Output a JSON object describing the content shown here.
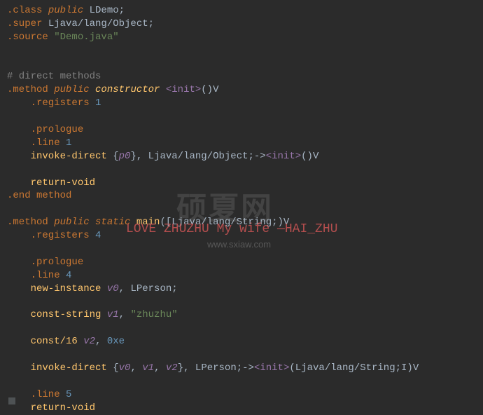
{
  "code": {
    "l1_dir": ".class ",
    "l1_mod": "public ",
    "l1_type": "LDemo",
    "l1_semi": ";",
    "l2_dir": ".super ",
    "l2_type": "Ljava/lang/Object",
    "l2_semi": ";",
    "l3_dir": ".source ",
    "l3_str": "\"Demo.java\"",
    "l5_comment": "# direct methods",
    "l6_dir": ".method ",
    "l6_mod": "public ",
    "l6_constr": "constructor ",
    "l6_spec1": "<init>",
    "l6_sig": "()",
    "l6_ret": "V",
    "l7_dir": "    .registers ",
    "l7_num": "1",
    "l9_dir": "    .prologue",
    "l10_dir": "    .line ",
    "l10_num": "1",
    "l11_op": "    invoke-direct ",
    "l11_brace1": "{",
    "l11_var": "p0",
    "l11_brace2": "}",
    "l11_comma": ", ",
    "l11_type": "Ljava/lang/Object",
    "l11_semi": ";",
    "l11_arrow": "->",
    "l11_spec": "<init>",
    "l11_sig": "()",
    "l11_ret": "V",
    "l13_op": "    return-void",
    "l14_dir": ".end method",
    "l16_dir": ".method ",
    "l16_mod1": "public ",
    "l16_mod2": "static ",
    "l16_func": "main",
    "l16_paren1": "(",
    "l16_arr": "[",
    "l16_type": "Ljava/lang/String",
    "l16_semi": ";",
    "l16_paren2": ")",
    "l16_ret": "V",
    "l17_dir": "    .registers ",
    "l17_num": "4",
    "l19_dir": "    .prologue",
    "l20_dir": "    .line ",
    "l20_num": "4",
    "l21_op": "    new-instance ",
    "l21_var": "v0",
    "l21_comma": ", ",
    "l21_type": "LPerson",
    "l21_semi": ";",
    "l23_op": "    const-string ",
    "l23_var": "v1",
    "l23_comma": ", ",
    "l23_str": "\"zhuzhu\"",
    "l25_op": "    const/16 ",
    "l25_var": "v2",
    "l25_comma": ", ",
    "l25_num": "0xe",
    "l27_op": "    invoke-direct ",
    "l27_brace1": "{",
    "l27_v0": "v0",
    "l27_c1": ", ",
    "l27_v1": "v1",
    "l27_c2": ", ",
    "l27_v2": "v2",
    "l27_brace2": "}",
    "l27_comma": ", ",
    "l27_type": "LPerson",
    "l27_semi": ";",
    "l27_arrow": "->",
    "l27_spec": "<init>",
    "l27_paren1": "(",
    "l27_ptype": "Ljava/lang/String",
    "l27_psemi": ";",
    "l27_pi": "I",
    "l27_paren2": ")",
    "l27_ret": "V",
    "l29_dir": "    .line ",
    "l29_num": "5",
    "l30_op": "    return-void"
  },
  "watermark": {
    "logo": "硕夏网",
    "text": "LOVE ZHUZHU My wife —HAI_ZHU",
    "url": "www.sxiaw.com"
  }
}
